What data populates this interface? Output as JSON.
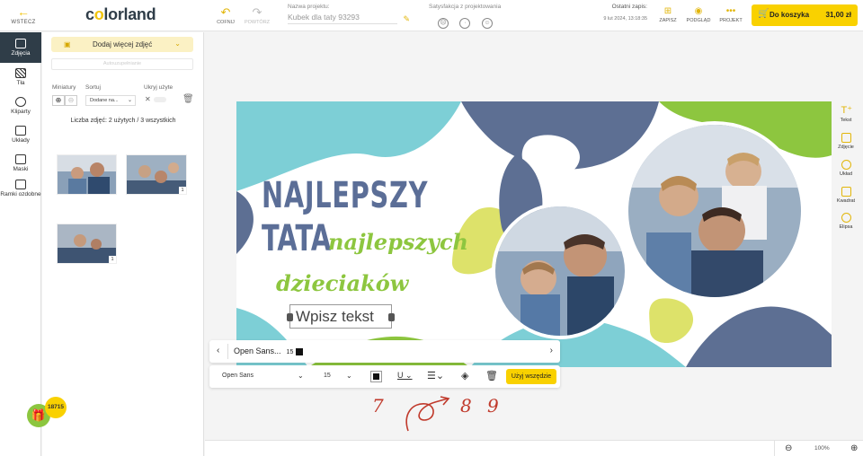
{
  "topbar": {
    "back_label": "WSTECZ",
    "logo_prefix": "c",
    "logo_o": "o",
    "logo_rest": "lorland",
    "undo_label": "COFNIJ",
    "redo_label": "POWTÓRZ",
    "project_name_label": "Nazwa projektu:",
    "project_name_value": "Kubek dla taty 93293",
    "satisfaction_label": "Satysfakcja z projektowania",
    "last_save_label": "Ostatni zapis:",
    "last_save_value": "9 lut 2024, 13:18:35",
    "save_label": "ZAPISZ",
    "preview_label": "PODGLĄD",
    "project_label": "PROJEKT",
    "cart_label": "Do koszyka",
    "cart_price": "31,00 zł"
  },
  "rail": {
    "items": [
      {
        "label": "Zdjęcia"
      },
      {
        "label": "Tła"
      },
      {
        "label": "Kliparty"
      },
      {
        "label": "Układy"
      },
      {
        "label": "Maski"
      },
      {
        "label": "Ramki ozdobne"
      }
    ]
  },
  "panel": {
    "add_photos_label": "Dodaj więcej zdjęć",
    "auto_fill_label": "Autouzupełnianie",
    "thumbs_label": "Miniatury",
    "sort_label": "Sortuj",
    "hide_used_label": "Ukryj użyte",
    "sort_value": "Dodane na...",
    "photo_count": "Liczba zdjęć: 2 użytych / 3 wszystkich",
    "thumb_badges": [
      "1",
      "1"
    ],
    "gift_count": "18715"
  },
  "design": {
    "line1": "NAJLEPSZY",
    "line2": "TATA",
    "line3": "najlepszych",
    "line4": "dzieciaków",
    "text_box": "Wpisz tekst"
  },
  "right_tools": {
    "items": [
      {
        "label": "Tekst"
      },
      {
        "label": "Zdjęcie"
      },
      {
        "label": "Układ"
      },
      {
        "label": "Kwadrat"
      },
      {
        "label": "Elipsa"
      }
    ]
  },
  "font_bar": {
    "chip_font": "Open Sans...",
    "chip_size": "15",
    "font_value": "Open Sans",
    "size_value": "15",
    "use_everywhere_label": "Użyj wszędzie"
  },
  "annotations": [
    "7",
    "8",
    "9"
  ],
  "bottom_bar": {
    "zoom_value": "100%"
  },
  "colors": {
    "accent": "#f9d100",
    "dark": "#2f3d48",
    "navy_text": "#5b6e97",
    "lime_text": "#8dc63f",
    "teal_shape": "#7dcfd6",
    "denim_shape": "#5d6f93"
  },
  "icons": {
    "back": "arrow-left-icon",
    "undo": "undo-icon",
    "redo": "redo-icon",
    "edit": "pencil-icon",
    "cart": "cart-icon",
    "zoom_in": "zoom-in-icon",
    "zoom_out": "zoom-out-icon",
    "trash": "trash-icon",
    "gift": "gift-icon"
  }
}
